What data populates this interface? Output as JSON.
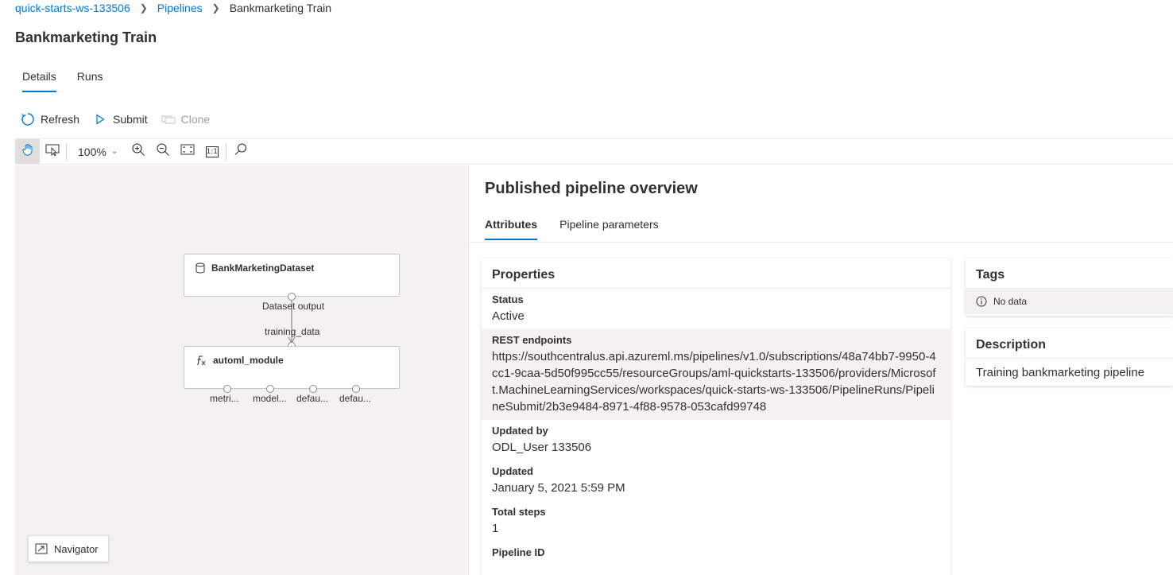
{
  "breadcrumb": {
    "workspace": "quick-starts-ws-133506",
    "section": "Pipelines",
    "current": "Bankmarketing Train"
  },
  "page": {
    "title": "Bankmarketing Train"
  },
  "tabs": [
    {
      "label": "Details",
      "active": true
    },
    {
      "label": "Runs",
      "active": false
    }
  ],
  "commands": {
    "refresh": "Refresh",
    "submit": "Submit",
    "clone": "Clone"
  },
  "canvas_toolbar": {
    "zoom": "100%",
    "actual_size": "1:1"
  },
  "graph": {
    "dataset_node": {
      "title": "BankMarketingDataset",
      "output_label": "Dataset output"
    },
    "module_node": {
      "title": "automl_module",
      "input_label": "training_data"
    },
    "outputs": [
      "metri...",
      "model...",
      "defau...",
      "defau..."
    ]
  },
  "navigator": {
    "label": "Navigator"
  },
  "overview": {
    "title": "Published pipeline overview",
    "tabs": [
      {
        "label": "Attributes",
        "active": true
      },
      {
        "label": "Pipeline parameters",
        "active": false
      }
    ],
    "properties": {
      "header": "Properties",
      "items": [
        {
          "label": "Status",
          "value": "Active"
        },
        {
          "label": "REST endpoints",
          "value": "https://southcentralus.api.azureml.ms/pipelines/v1.0/subscriptions/48a74bb7-9950-4cc1-9caa-5d50f995cc55/resourceGroups/aml-quickstarts-133506/providers/Microsoft.MachineLearningServices/workspaces/quick-starts-ws-133506/PipelineRuns/PipelineSubmit/2b3e9484-8971-4f88-9578-053cafd99748"
        },
        {
          "label": "Updated by",
          "value": "ODL_User 133506"
        },
        {
          "label": "Updated",
          "value": "January 5, 2021 5:59 PM"
        },
        {
          "label": "Total steps",
          "value": "1"
        },
        {
          "label": "Pipeline ID",
          "value": ""
        }
      ]
    },
    "tags": {
      "header": "Tags",
      "empty": "No data"
    },
    "description": {
      "header": "Description",
      "value": "Training bankmarketing pipeline"
    }
  },
  "colors": {
    "accent": "#0078d4",
    "canvas": "#f3f2f1",
    "text": "#323130"
  }
}
